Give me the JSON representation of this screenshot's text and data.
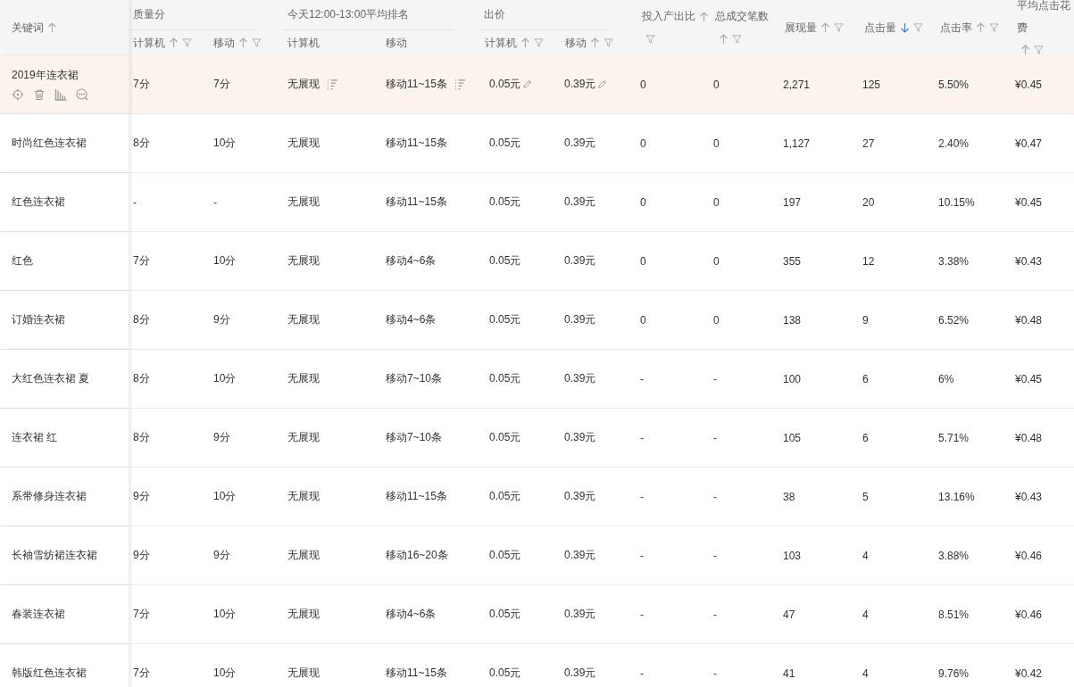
{
  "columns": [
    {
      "label": "关键词",
      "sortable": true,
      "sorted_desc": false
    },
    {
      "label": "质量分",
      "children": [
        {
          "label": "计算机",
          "sortable": true,
          "sorted_desc": false,
          "filter": true
        },
        {
          "label": "移动",
          "sortable": true,
          "sorted_desc": false,
          "filter": true
        }
      ]
    },
    {
      "label": "今天12:00-13:00平均排名",
      "children": [
        {
          "label": "计算机"
        },
        {
          "label": "移动"
        }
      ]
    },
    {
      "label": "出价",
      "children": [
        {
          "label": "计算机",
          "sortable": true,
          "sorted_desc": false,
          "filter": true
        },
        {
          "label": "移动",
          "sortable": true,
          "sorted_desc": false,
          "filter": true
        }
      ]
    },
    {
      "label": "投入产出比",
      "sortable": true,
      "sorted_desc": false,
      "filter": true
    },
    {
      "label": "总成交笔数",
      "sortable": true,
      "sorted_desc": false,
      "filter": true
    },
    {
      "label": "展现量",
      "sortable": true,
      "sorted_desc": false,
      "filter": true
    },
    {
      "label": "点击量",
      "sortable": true,
      "sorted_desc": true,
      "filter": true
    },
    {
      "label": "点击率",
      "sortable": true,
      "sorted_desc": false,
      "filter": true
    },
    {
      "label": "平均点击花费",
      "sortable": true,
      "sorted_desc": false,
      "filter": true
    }
  ],
  "rows": [
    {
      "keyword": "2019年连衣裙",
      "selected": true,
      "cells": [
        "7分",
        "7分",
        "无展现",
        "移动11~15条",
        "0.05元",
        "0.39元",
        "0",
        "0",
        "2,271",
        "125",
        "5.50%",
        "¥0.45"
      ]
    },
    {
      "keyword": "时尚红色连衣裙",
      "selected": false,
      "cells": [
        "8分",
        "10分",
        "无展现",
        "移动11~15条",
        "0.05元",
        "0.39元",
        "0",
        "0",
        "1,127",
        "27",
        "2.40%",
        "¥0.47"
      ]
    },
    {
      "keyword": "红色连衣裙",
      "selected": false,
      "cells": [
        "-",
        "-",
        "无展现",
        "移动11~15条",
        "0.05元",
        "0.39元",
        "0",
        "0",
        "197",
        "20",
        "10.15%",
        "¥0.45"
      ]
    },
    {
      "keyword": "红色",
      "selected": false,
      "cells": [
        "7分",
        "10分",
        "无展现",
        "移动4~6条",
        "0.05元",
        "0.39元",
        "0",
        "0",
        "355",
        "12",
        "3.38%",
        "¥0.43"
      ]
    },
    {
      "keyword": "订婚连衣裙",
      "selected": false,
      "cells": [
        "8分",
        "9分",
        "无展现",
        "移动4~6条",
        "0.05元",
        "0.39元",
        "0",
        "0",
        "138",
        "9",
        "6.52%",
        "¥0.48"
      ]
    },
    {
      "keyword": "大红色连衣裙 夏",
      "selected": false,
      "cells": [
        "8分",
        "10分",
        "无展现",
        "移动7~10条",
        "0.05元",
        "0.39元",
        "-",
        "-",
        "100",
        "6",
        "6%",
        "¥0.45"
      ]
    },
    {
      "keyword": "连衣裙 红",
      "selected": false,
      "cells": [
        "8分",
        "9分",
        "无展现",
        "移动7~10条",
        "0.05元",
        "0.39元",
        "-",
        "-",
        "105",
        "6",
        "5.71%",
        "¥0.48"
      ]
    },
    {
      "keyword": "系带修身连衣裙",
      "selected": false,
      "cells": [
        "9分",
        "10分",
        "无展现",
        "移动11~15条",
        "0.05元",
        "0.39元",
        "-",
        "-",
        "38",
        "5",
        "13.16%",
        "¥0.43"
      ]
    },
    {
      "keyword": "长袖雪纺裙连衣裙",
      "selected": false,
      "cells": [
        "9分",
        "9分",
        "无展现",
        "移动16~20条",
        "0.05元",
        "0.39元",
        "-",
        "-",
        "103",
        "4",
        "3.88%",
        "¥0.46"
      ]
    },
    {
      "keyword": "春装连衣裙",
      "selected": false,
      "cells": [
        "7分",
        "10分",
        "无展现",
        "移动4~6条",
        "0.05元",
        "0.39元",
        "-",
        "-",
        "47",
        "4",
        "8.51%",
        "¥0.46"
      ]
    },
    {
      "keyword": "韩版红色连衣裙",
      "selected": false,
      "cells": [
        "7分",
        "10分",
        "无展现",
        "移动11~15条",
        "0.05元",
        "0.39元",
        "-",
        "-",
        "41",
        "4",
        "9.76%",
        "¥0.42"
      ]
    }
  ]
}
